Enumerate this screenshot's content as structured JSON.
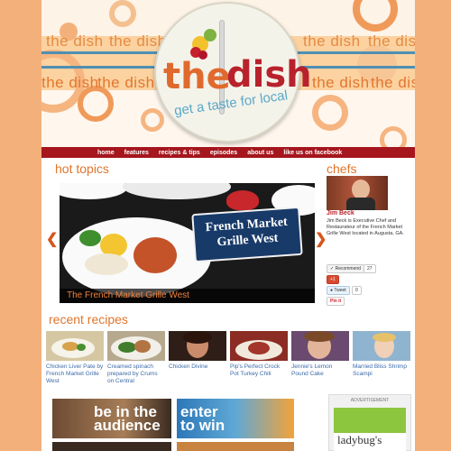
{
  "header": {
    "tile_text": "the dish",
    "logo_the": "the",
    "logo_dish": "dish",
    "tagline": "get a taste for local"
  },
  "nav": {
    "items": [
      "home",
      "features",
      "recipes & tips",
      "episodes",
      "about us",
      "like us on facebook"
    ]
  },
  "hot_topics": {
    "title": "hot topics",
    "sign_text": "French Market Grille West",
    "caption": "The French Market Grille West",
    "prev_icon": "chevron-left-icon",
    "next_icon": "chevron-right-icon"
  },
  "chefs": {
    "title": "chefs",
    "name": "Jim Beck",
    "bio": "Jim Beck is Executive Chef and Restaurateur of the French Market Grille West located in Augusta, GA.",
    "recommend_label": "Recommend",
    "recommend_count": "27",
    "plus_label": "+1",
    "tweet_label": "Tweet",
    "tweet_count": "0",
    "pin_label": "Pin it"
  },
  "recent_recipes": {
    "title": "recent recipes",
    "items": [
      {
        "label": "Chicken Liver Pate by French Market Grille West"
      },
      {
        "label": "Creamed spinach prepared by Crums on Central"
      },
      {
        "label": "Chicken Divine"
      },
      {
        "label": "Pip's Perfect Crock Pot Turkey Chili"
      },
      {
        "label": "Jennie's Lemon Pound Cake"
      },
      {
        "label": "Married Bliss Shrimp Scampi"
      }
    ]
  },
  "promos": {
    "audience": "be in the audience",
    "win": "enter to win"
  },
  "ad": {
    "label": "ADVERTISEMENT",
    "text": "ladybug's"
  },
  "colors": {
    "background": "#f4b07b",
    "nav": "#a5161d",
    "accent": "#e0752c",
    "link": "#3b6aa8"
  }
}
